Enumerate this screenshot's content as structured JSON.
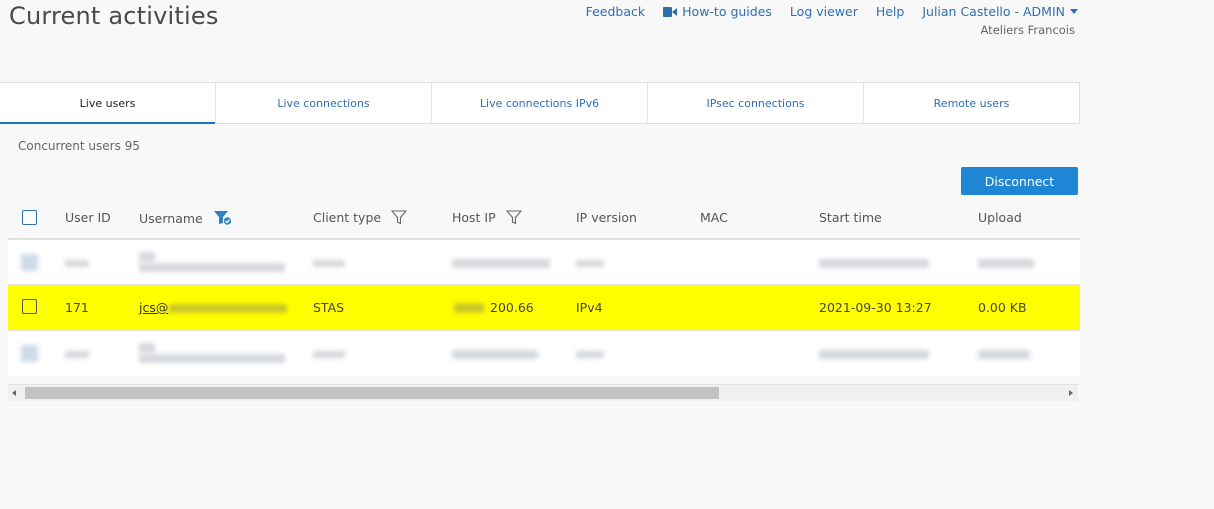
{
  "page": {
    "title": "Current activities"
  },
  "top_nav": {
    "feedback": "Feedback",
    "howto": "How-to guides",
    "log_viewer": "Log viewer",
    "help": "Help",
    "user": "Julian Castello - ADMIN",
    "org": "Ateliers Francois"
  },
  "tabs": [
    {
      "label": "Live users",
      "active": true
    },
    {
      "label": "Live connections"
    },
    {
      "label": "Live connections IPv6"
    },
    {
      "label": "IPsec connections"
    },
    {
      "label": "Remote users"
    }
  ],
  "concurrent": "Concurrent users 95",
  "disconnect_label": "Disconnect",
  "table": {
    "columns": [
      "User ID",
      "Username",
      "Client type",
      "Host IP",
      "IP version",
      "MAC",
      "Start time",
      "Upload"
    ],
    "highlighted_row": {
      "user_id": "171",
      "username": "jcs@",
      "client_type": "STAS",
      "host_ip": "200.66",
      "ip_version": "IPv4",
      "mac": "",
      "start_time": "2021-09-30 13:27",
      "upload": "0.00 KB"
    }
  },
  "colors": {
    "accent": "#1f86d6",
    "highlight": "#ffff00",
    "link": "#2f6fb0"
  }
}
